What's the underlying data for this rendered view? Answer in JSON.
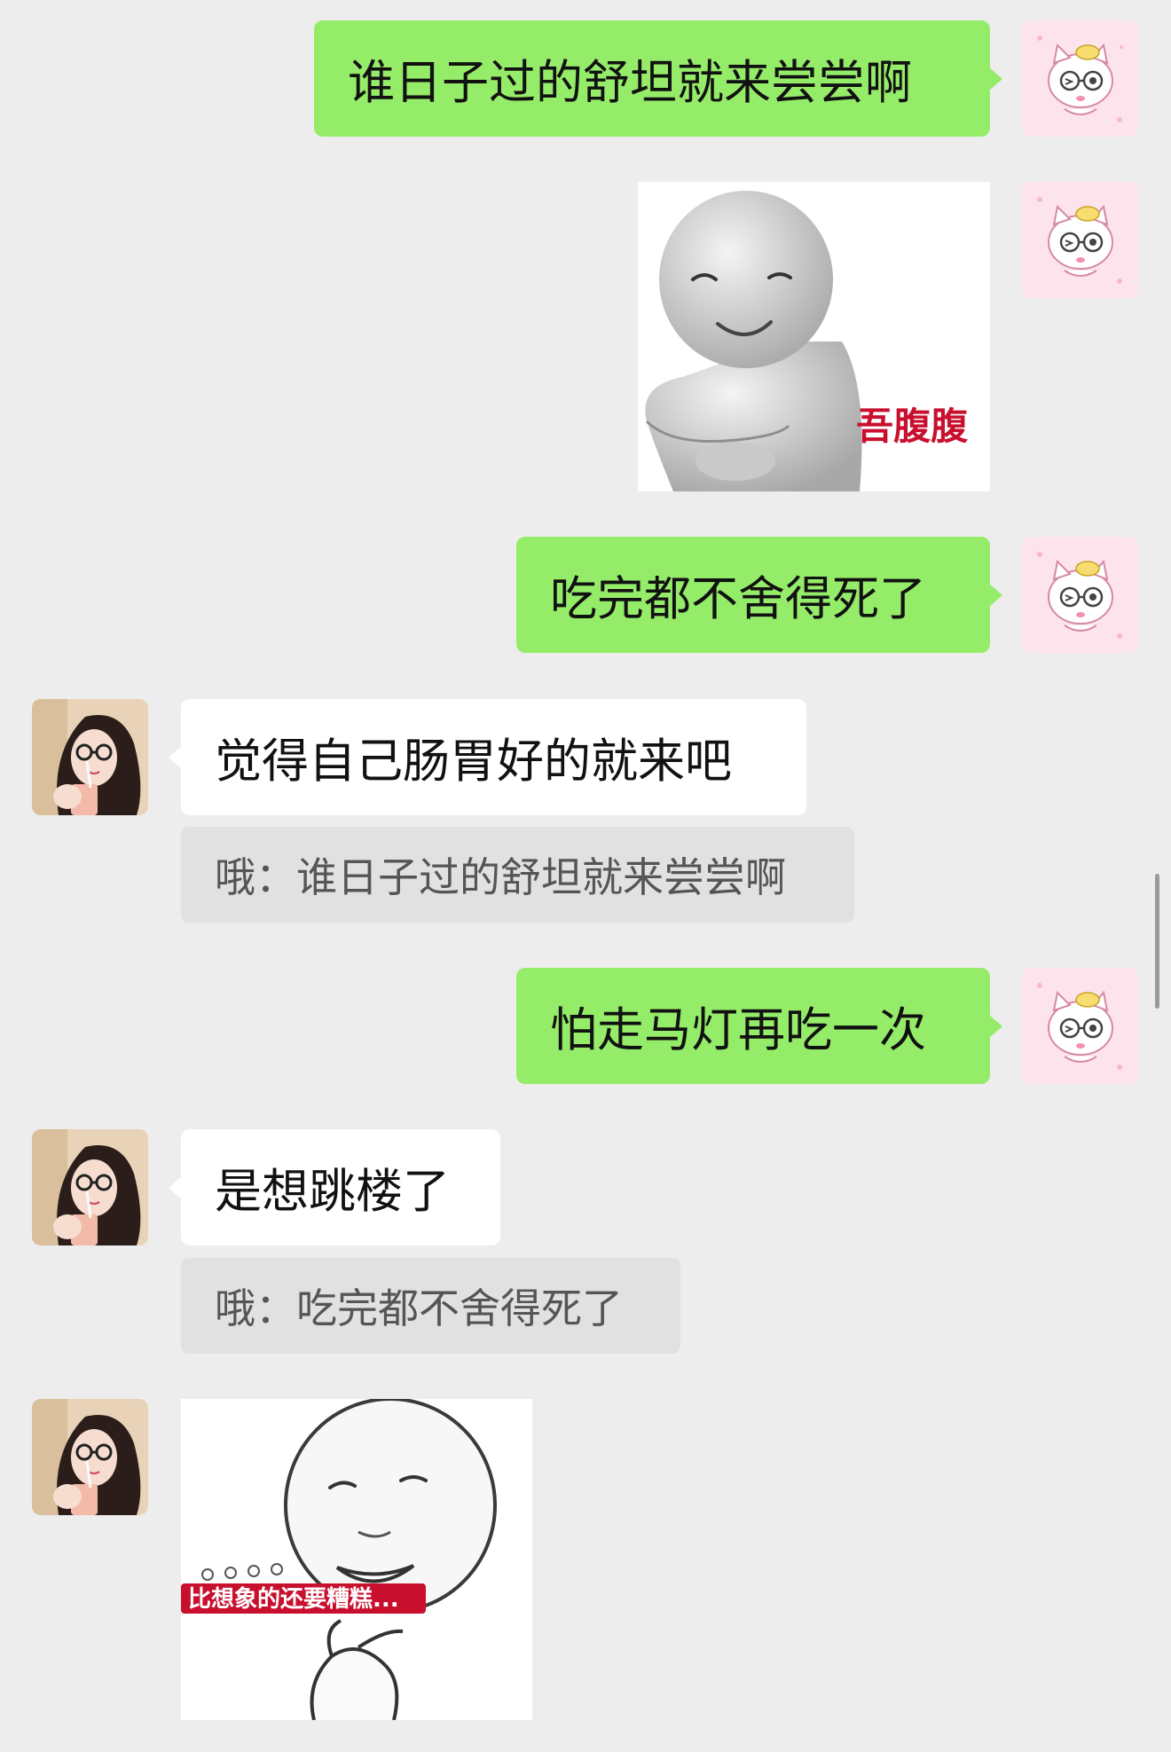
{
  "messages": [
    {
      "side": "me",
      "type": "text",
      "text": "谁日子过的舒坦就来尝尝啊"
    },
    {
      "side": "me",
      "type": "sticker",
      "caption": "吾腹腹"
    },
    {
      "side": "me",
      "type": "text",
      "text": "吃完都不舍得死了"
    },
    {
      "side": "other",
      "type": "text",
      "text": "觉得自己肠胃好的就来吧",
      "quote": "哦：谁日子过的舒坦就来尝尝啊"
    },
    {
      "side": "me",
      "type": "text",
      "text": "怕走马灯再吃一次"
    },
    {
      "side": "other",
      "type": "text",
      "text": "是想跳楼了",
      "quote": "哦：吃完都不舍得死了"
    },
    {
      "side": "other",
      "type": "sticker",
      "caption": "比想象的还要糟糕..."
    }
  ],
  "colors": {
    "background": "#ededed",
    "my_bubble": "#95ec69",
    "their_bubble": "#ffffff",
    "quote_bg": "#e1e1e1",
    "sticker_caption_red": "#c8102e"
  },
  "icons": {
    "my_avatar": "pink-cartoon-cat-with-glasses",
    "their_avatar": "girl-with-glasses-selfie"
  }
}
